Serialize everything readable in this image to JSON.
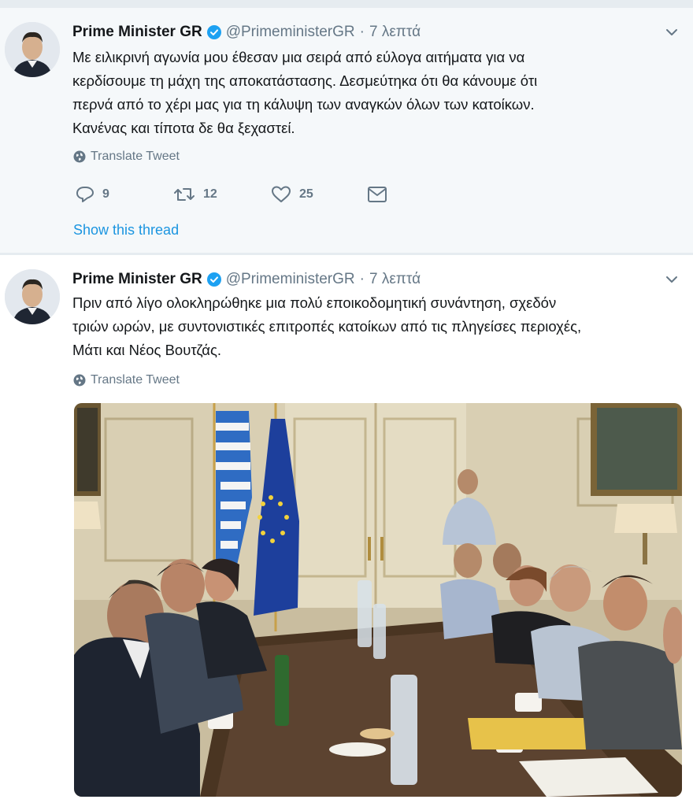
{
  "tweets": [
    {
      "name": "Prime Minister GR",
      "handle": "@PrimeministerGR",
      "separator": "·",
      "time": "7 λεπτά",
      "text_lines": [
        "Με ειλικρινή αγωνία μου έθεσαν μια σειρά από εύλογα αιτήματα για να",
        "κερδίσουμε τη μάχη της αποκατάστασης. Δεσμεύτηκα ότι θα κάνουμε ότι",
        "περνά από το χέρι μας για τη κάλυψη των αναγκών όλων των κατοίκων.",
        "Κανένας και τίποτα δε θα ξεχαστεί."
      ],
      "translate_label": "Translate Tweet",
      "reply_count": "9",
      "retweet_count": "12",
      "like_count": "25",
      "thread_link": "Show this thread"
    },
    {
      "name": "Prime Minister GR",
      "handle": "@PrimeministerGR",
      "separator": "·",
      "time": "7 λεπτά",
      "text_lines": [
        "Πριν από λίγο ολοκληρώθηκε μια πολύ εποικοδομητική συνάντηση, σχεδόν",
        "τριών ωρών, με συντονιστικές επιτροπές κατοίκων από τις πληγείσες περιοχές,",
        "Μάτι και Νέος Βουτζάς."
      ],
      "translate_label": "Translate Tweet"
    }
  ],
  "icons": {
    "verified": "verified-badge-icon",
    "caret": "chevron-down-icon",
    "globe": "globe-icon",
    "reply": "reply-icon",
    "retweet": "retweet-icon",
    "like": "heart-icon",
    "dm": "envelope-icon"
  },
  "colors": {
    "link": "#1b95e0",
    "muted": "#657786",
    "verified": "#1da1f2"
  }
}
